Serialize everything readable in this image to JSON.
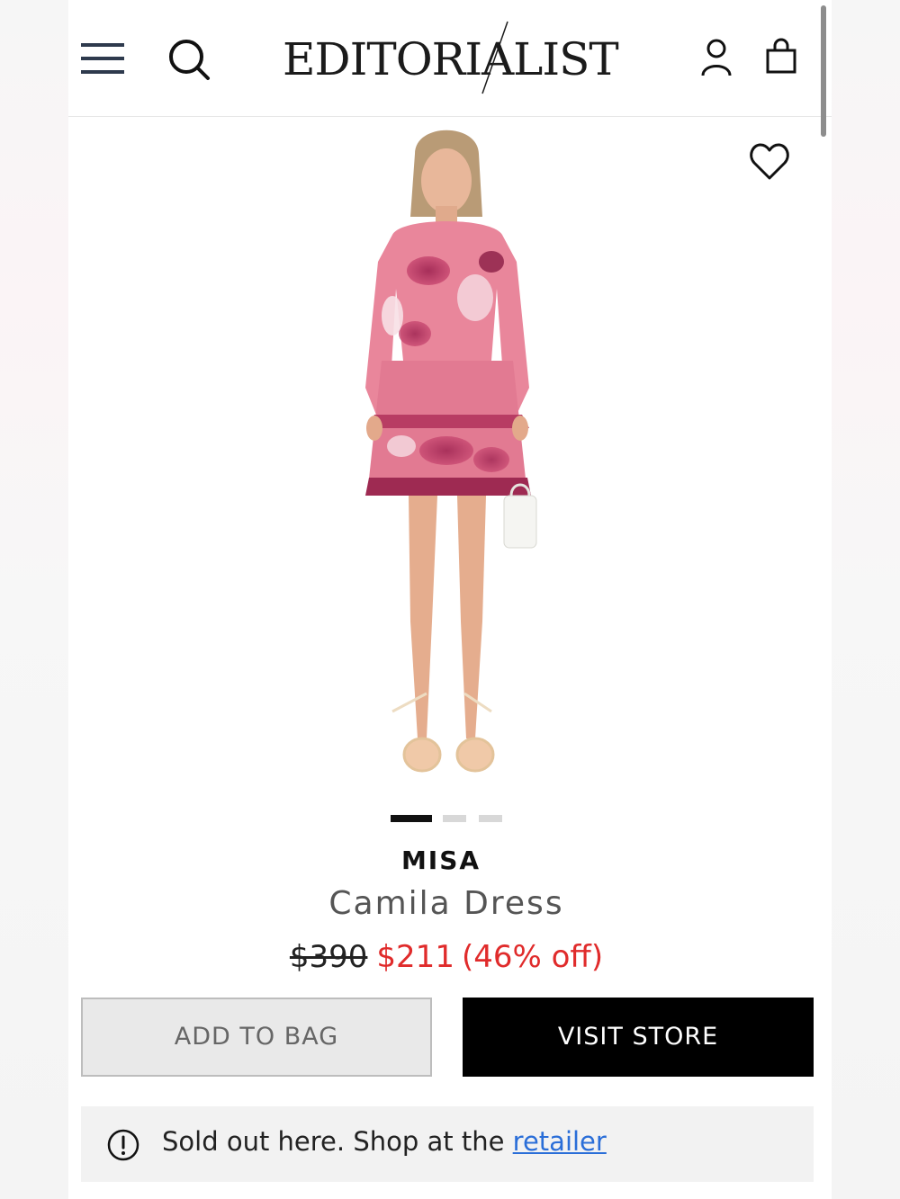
{
  "header": {
    "logo_text": "EDITORIALIST",
    "icons": [
      "menu-icon",
      "search-icon",
      "account-icon",
      "shopping-bag-icon"
    ]
  },
  "product": {
    "image_icon": "wishlist-heart-icon",
    "carousel": {
      "count": 3,
      "active_index": 0
    },
    "brand": "MISA",
    "name": "Camila Dress",
    "price_original": "$390",
    "price_sale": "$211",
    "discount": "(46% off)"
  },
  "actions": {
    "add_to_bag": "ADD TO BAG",
    "visit_store": "VISIT STORE"
  },
  "notice": {
    "icon": "alert-circle-icon",
    "text": "Sold out here. Shop at the ",
    "link_text": "retailer"
  },
  "colors": {
    "sale_price": "#e02b2b",
    "link": "#2a6ed8",
    "primary_button": "#000000",
    "dress_pink": "#e87c93",
    "dress_magenta": "#9b1f4e"
  }
}
